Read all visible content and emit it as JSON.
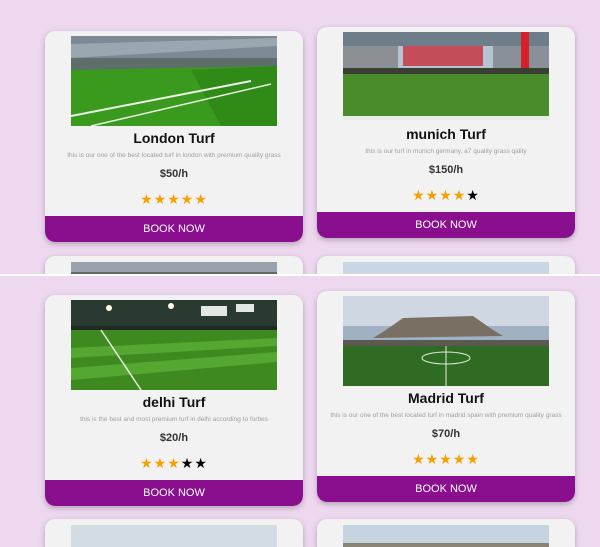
{
  "theme": {
    "page_bg": "#eed8f0",
    "card_bg": "#f2f2f2",
    "button_bg": "#8a0f8f",
    "star_on": "#f5a000",
    "star_off": "#000000"
  },
  "top_view": {
    "cards": [
      {
        "title": "London Turf",
        "description": "this is our one of the best located turf in london with premium quality grass",
        "price": "$50/h",
        "rating": 5,
        "button": "BOOK NOW"
      },
      {
        "title": "munich Turf",
        "description": "this is our turf in munich germany, a7 quality grass qality",
        "price": "$150/h",
        "rating": 4,
        "button": "BOOK NOW"
      }
    ]
  },
  "bottom_view": {
    "cards": [
      {
        "title": "delhi Turf",
        "description": "this is the best and most premium turf in delhi according to forbes",
        "price": "$20/h",
        "rating": 3,
        "button": "BOOK NOW"
      },
      {
        "title": "Madrid Turf",
        "description": "this is our one of the best located turf in madrid spain with premium quality grass",
        "price": "$70/h",
        "rating": 5,
        "button": "BOOK NOW"
      }
    ]
  },
  "icons": {
    "star": "star-icon"
  },
  "star_glyph": "★"
}
